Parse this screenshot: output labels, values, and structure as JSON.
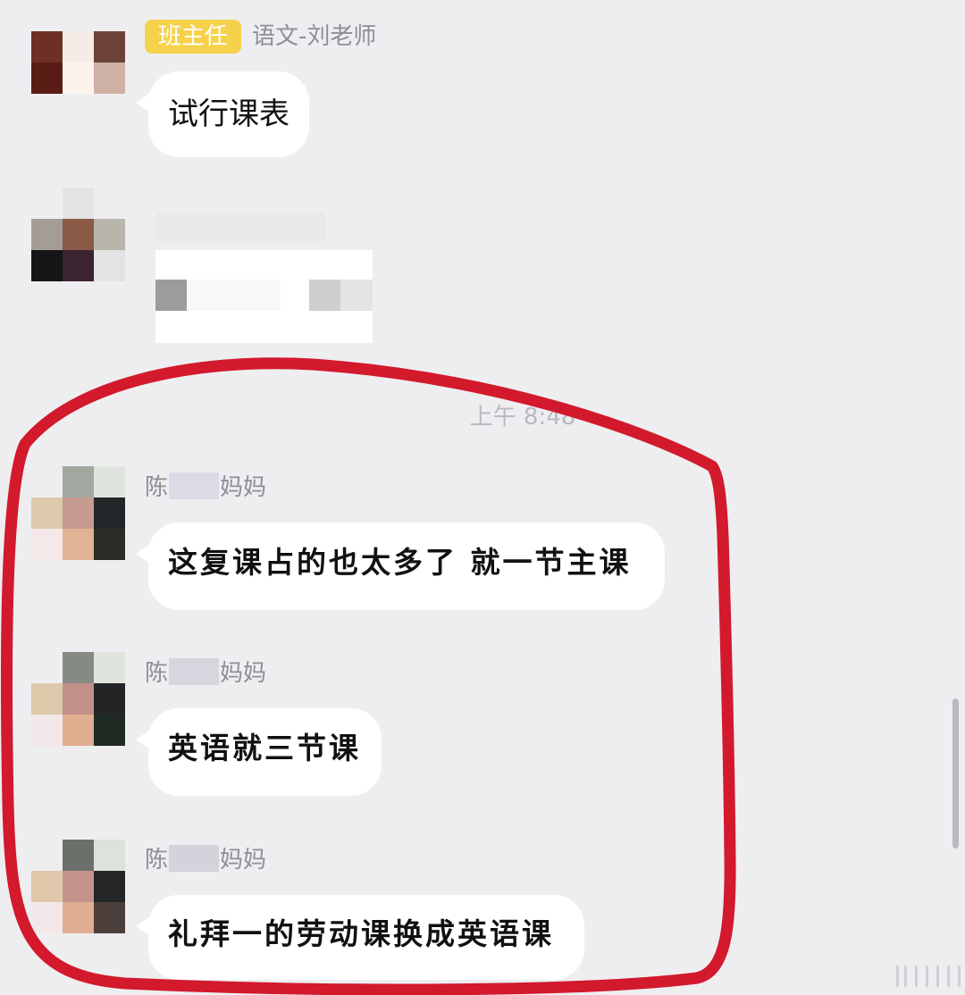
{
  "messages": [
    {
      "role_tag": "班主任",
      "sender": "语文-刘老师",
      "text": "试行课表"
    },
    {
      "timestamp": "上午 8:48"
    },
    {
      "sender_prefix": "陈",
      "sender_suffix": "妈妈",
      "text": "这复课占的也太多了 就一节主课"
    },
    {
      "sender_prefix": "陈",
      "sender_suffix": "妈妈",
      "text": "英语就三节课"
    },
    {
      "sender_prefix": "陈",
      "sender_suffix": "妈妈",
      "text": "礼拜一的劳动课换成英语课"
    }
  ],
  "colors": {
    "background": "#eeeef1",
    "bubble": "#ffffff",
    "role_tag": "#f6d24c",
    "annotation_circle": "#d3192c"
  }
}
